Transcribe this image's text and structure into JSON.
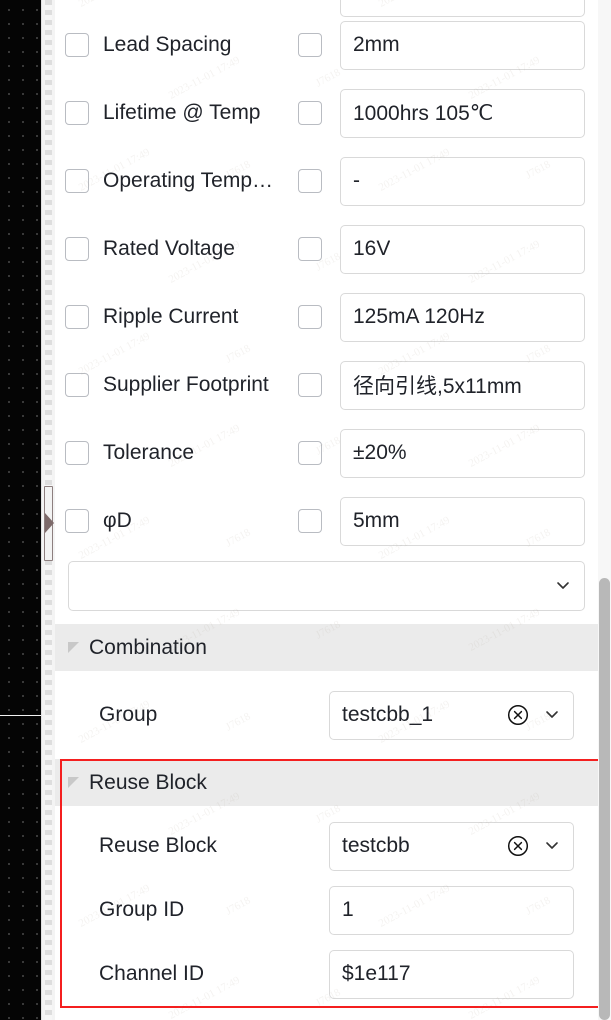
{
  "canvas": {
    "name": "pcb-canvas",
    "background_color": "#050505",
    "dot_color": "#4a4a4a"
  },
  "watermark": {
    "text_date": "2023-11-01 17:49",
    "text_id": "J7618"
  },
  "panel": {
    "properties": [
      {
        "label": "Lead Spacing",
        "value": "2mm",
        "name_checked": false,
        "value_checked": false
      },
      {
        "label": "Lifetime @ Temp",
        "value": "1000hrs 105℃",
        "name_checked": false,
        "value_checked": false
      },
      {
        "label": "Operating Temp…",
        "value": "-",
        "name_checked": false,
        "value_checked": false
      },
      {
        "label": "Rated Voltage",
        "value": "16V",
        "name_checked": false,
        "value_checked": false
      },
      {
        "label": "Ripple Current",
        "value": "125mA 120Hz",
        "name_checked": false,
        "value_checked": false
      },
      {
        "label": "Supplier Footprint",
        "value": "径向引线,5x11mm",
        "name_checked": false,
        "value_checked": false
      },
      {
        "label": "Tolerance",
        "value": "±20%",
        "name_checked": false,
        "value_checked": false
      },
      {
        "label": "φD",
        "value": "5mm",
        "name_checked": false,
        "value_checked": false
      }
    ],
    "add_property_select": {
      "value": "",
      "placeholder": ""
    },
    "sections": [
      {
        "title": "Combination",
        "expanded": true,
        "highlighted": false,
        "rows": [
          {
            "label": "Group",
            "value": "testcbb_1",
            "type": "select",
            "clearable": true
          }
        ]
      },
      {
        "title": "Reuse Block",
        "expanded": true,
        "highlighted": true,
        "highlight_color": "#f41f1f",
        "rows": [
          {
            "label": "Reuse Block",
            "value": "testcbb",
            "type": "select",
            "clearable": true
          },
          {
            "label": "Group ID",
            "value": "1",
            "type": "text",
            "clearable": false
          },
          {
            "label": "Channel ID",
            "value": "$1e117",
            "type": "text",
            "clearable": false
          }
        ]
      }
    ],
    "scrollbar": {
      "orientation": "vertical",
      "thumb_color": "#b8b8b8"
    }
  },
  "icons": {
    "chevron_down": "chevron-down-icon",
    "clear_circle": "clear-circle-icon",
    "collapse_triangle": "collapse-triangle-icon",
    "panel_handle_arrow": "panel-expand-arrow-icon"
  }
}
